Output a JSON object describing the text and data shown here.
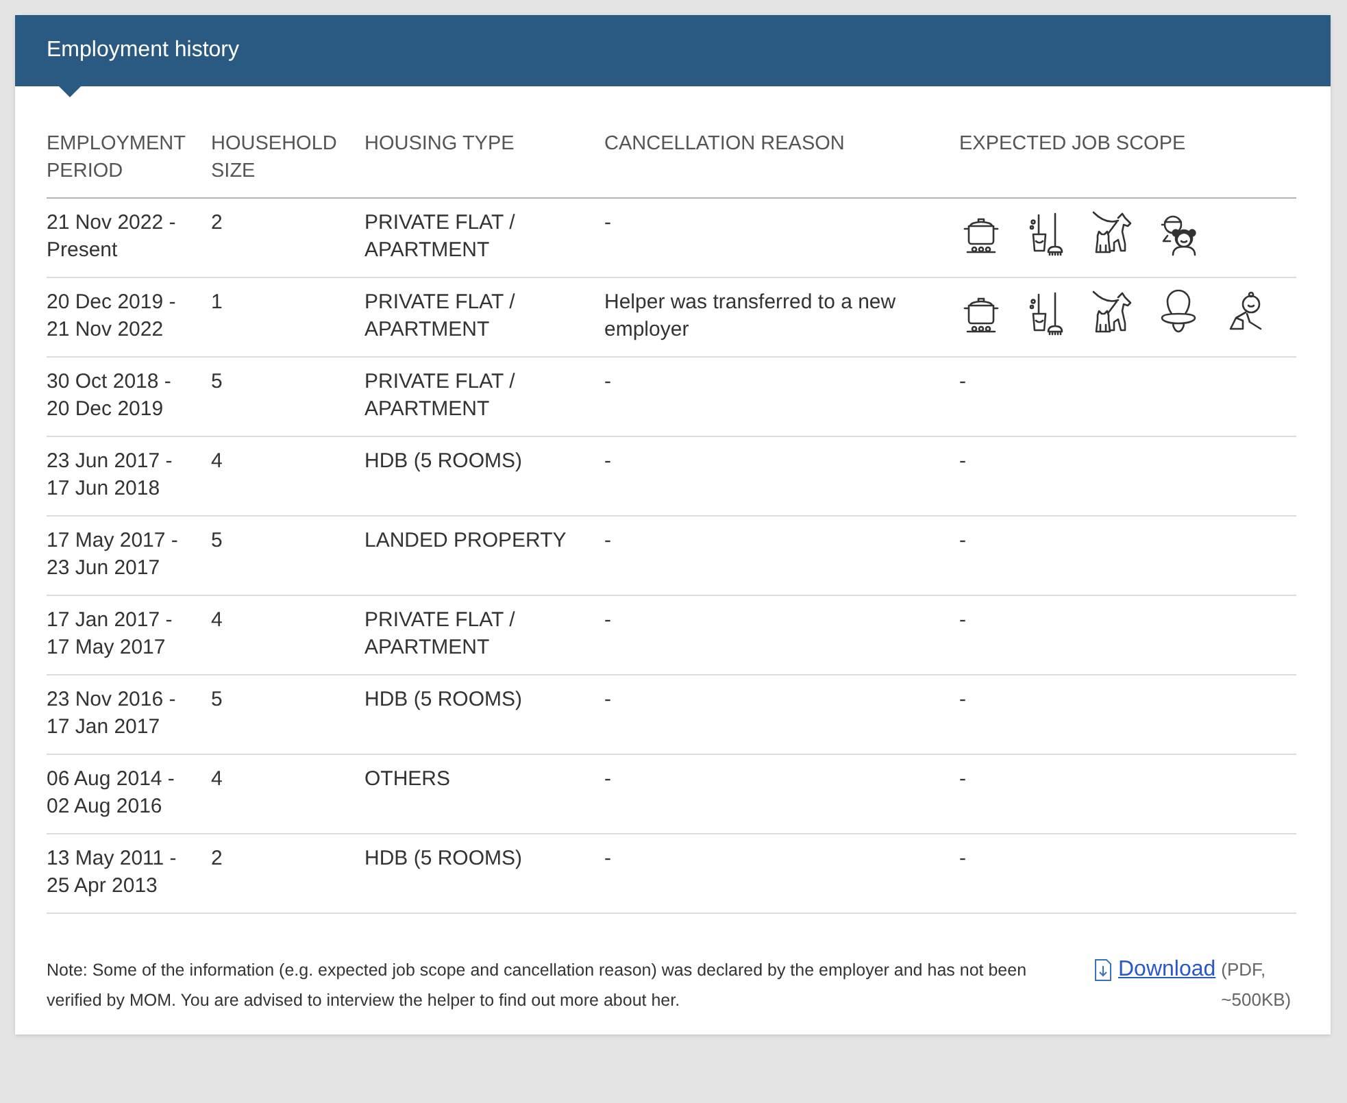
{
  "panel": {
    "title": "Employment history"
  },
  "table": {
    "columns": [
      "EMPLOYMENT PERIOD",
      "HOUSEHOLD SIZE",
      "HOUSING TYPE",
      "CANCELLATION REASON",
      "EXPECTED JOB SCOPE"
    ],
    "rows": [
      {
        "period": "21 Nov 2022 - Present",
        "household_size": "2",
        "housing_type": "PRIVATE FLAT / APARTMENT",
        "cancellation_reason": "-",
        "job_scope": [
          {
            "kind": "cooking"
          },
          {
            "kind": "cleaning"
          },
          {
            "kind": "pets"
          },
          {
            "kind": "children"
          }
        ]
      },
      {
        "period": "20 Dec 2019 - 21 Nov 2022",
        "household_size": "1",
        "housing_type": "PRIVATE FLAT / APARTMENT",
        "cancellation_reason": "Helper was transferred to a new employer",
        "job_scope": [
          {
            "kind": "cooking"
          },
          {
            "kind": "cleaning"
          },
          {
            "kind": "pets"
          },
          {
            "kind": "infant"
          },
          {
            "kind": "toddler"
          }
        ]
      },
      {
        "period": "30 Oct 2018 - 20 Dec 2019",
        "household_size": "5",
        "housing_type": "PRIVATE FLAT / APARTMENT",
        "cancellation_reason": "-",
        "job_scope_text": "-"
      },
      {
        "period": "23 Jun 2017 - 17 Jun 2018",
        "household_size": "4",
        "housing_type": "HDB (5 ROOMS)",
        "cancellation_reason": "-",
        "job_scope_text": "-"
      },
      {
        "period": "17 May 2017 - 23 Jun 2017",
        "household_size": "5",
        "housing_type": "LANDED PROPERTY",
        "cancellation_reason": "-",
        "job_scope_text": "-"
      },
      {
        "period": "17 Jan 2017 - 17 May 2017",
        "household_size": "4",
        "housing_type": "PRIVATE FLAT / APARTMENT",
        "cancellation_reason": "-",
        "job_scope_text": "-"
      },
      {
        "period": "23 Nov 2016 - 17 Jan 2017",
        "household_size": "5",
        "housing_type": "HDB (5 ROOMS)",
        "cancellation_reason": "-",
        "job_scope_text": "-"
      },
      {
        "period": "06 Aug 2014 - 02 Aug 2016",
        "household_size": "4",
        "housing_type": "OTHERS",
        "cancellation_reason": "-",
        "job_scope_text": "-"
      },
      {
        "period": "13 May 2011 - 25 Apr 2013",
        "household_size": "2",
        "housing_type": "HDB (5 ROOMS)",
        "cancellation_reason": "-",
        "job_scope_text": "-"
      }
    ]
  },
  "footer": {
    "note": "Note: Some of the information (e.g. expected job scope and cancellation reason) was declared by the employer and has not been verified by MOM. You are advised to interview the helper to find out more about her.",
    "download_link": "Download",
    "download_info": "(PDF, ~500KB)"
  }
}
